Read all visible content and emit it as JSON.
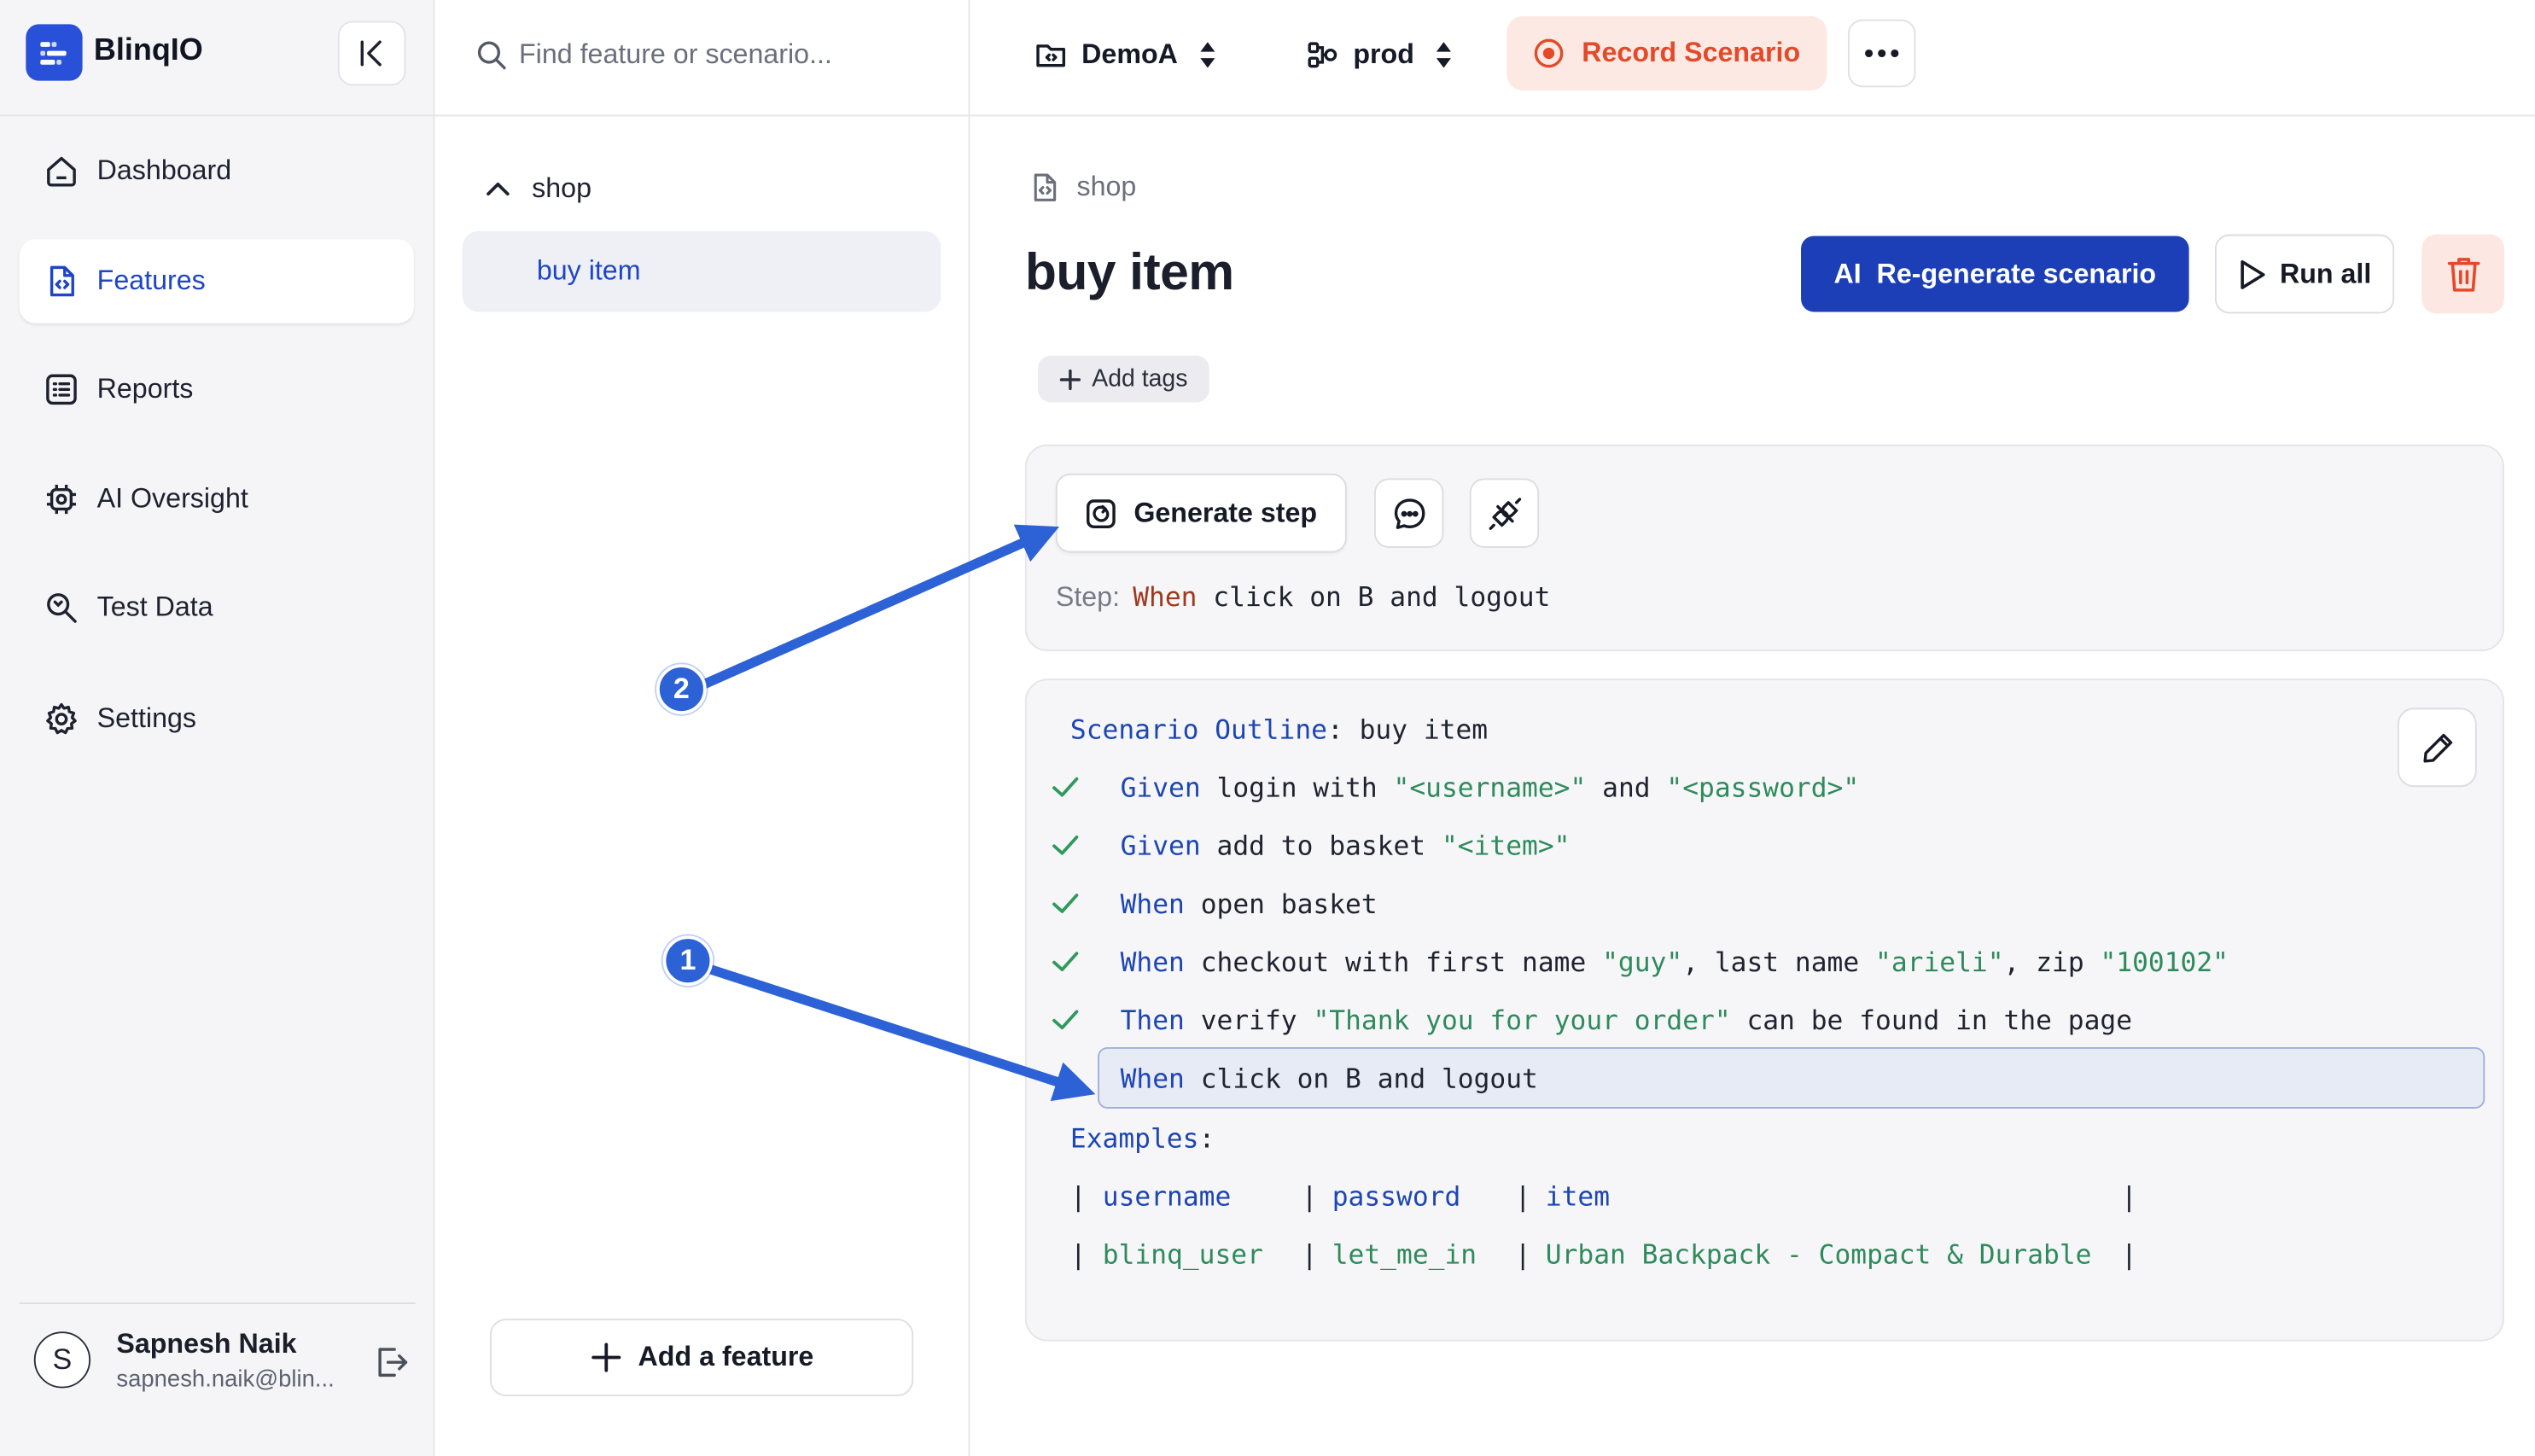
{
  "app": {
    "name": "BlinqIO"
  },
  "sidebar": {
    "items": [
      {
        "label": "Dashboard",
        "icon": "home-icon",
        "active": false
      },
      {
        "label": "Features",
        "icon": "feature-file-icon",
        "active": true
      },
      {
        "label": "Reports",
        "icon": "list-report-icon",
        "active": false
      },
      {
        "label": "AI Oversight",
        "icon": "ai-gear-icon",
        "active": false
      },
      {
        "label": "Test Data",
        "icon": "search-data-icon",
        "active": false
      },
      {
        "label": "Settings",
        "icon": "gear-icon",
        "active": false
      }
    ],
    "user": {
      "initial": "S",
      "name": "Sapnesh Naik",
      "email": "sapnesh.naik@blin..."
    }
  },
  "middle": {
    "search_placeholder": "Find feature or scenario...",
    "tree": {
      "folder": "shop",
      "item": "buy item"
    },
    "add_feature": "Add a feature"
  },
  "topbar": {
    "project": "DemoA",
    "environment": "prod",
    "record": "Record Scenario"
  },
  "main": {
    "breadcrumb": "shop",
    "title": "buy item",
    "regen_label": "AI  Re-generate scenario",
    "run_all": "Run all",
    "add_tags": "Add tags",
    "step_panel": {
      "generate_step": "Generate step",
      "step_label": "Step:",
      "step_keyword": "When",
      "step_text": " click on B and logout"
    },
    "scenario": {
      "header_kw": "Scenario Outline",
      "header_name": ": buy item",
      "steps": [
        {
          "kw": "Given",
          "parts": [
            " login with ",
            "\"<username>\"",
            " and ",
            "\"<password>\""
          ],
          "status": "passed"
        },
        {
          "kw": "Given",
          "parts": [
            " add to basket ",
            "\"<item>\""
          ],
          "status": "passed"
        },
        {
          "kw": "When",
          "parts": [
            " open basket"
          ],
          "status": "passed"
        },
        {
          "kw": "When",
          "parts": [
            " checkout with first name ",
            "\"guy\"",
            ", last name ",
            "\"arieli\"",
            ", zip ",
            "\"100102\""
          ],
          "status": "passed"
        },
        {
          "kw": "Then",
          "parts": [
            " verify ",
            "\"Thank you for your order\"",
            " can be found in the page"
          ],
          "status": "passed"
        },
        {
          "kw": "When",
          "parts": [
            " click on B and logout"
          ],
          "status": "selected"
        }
      ],
      "examples_kw": "Examples",
      "examples_colon": ":",
      "table": {
        "headers": [
          "username",
          "password",
          "item"
        ],
        "row": [
          "blinq_user",
          "let_me_in",
          "Urban Backpack - Compact & Durable"
        ]
      }
    },
    "annotations": {
      "badge_1": "1",
      "badge_2": "2"
    }
  },
  "colors": {
    "brand": "#2950d8",
    "active_nav_text": "#1e45c6",
    "record_bg": "#fde9e4",
    "record_text": "#e24a2a",
    "regen_bg": "#1c3fb8",
    "keyword_blue": "#1d46b3",
    "string_green": "#2f8a5c",
    "check_green": "#2f9a5c",
    "annotation_blue": "#2d62d6"
  }
}
